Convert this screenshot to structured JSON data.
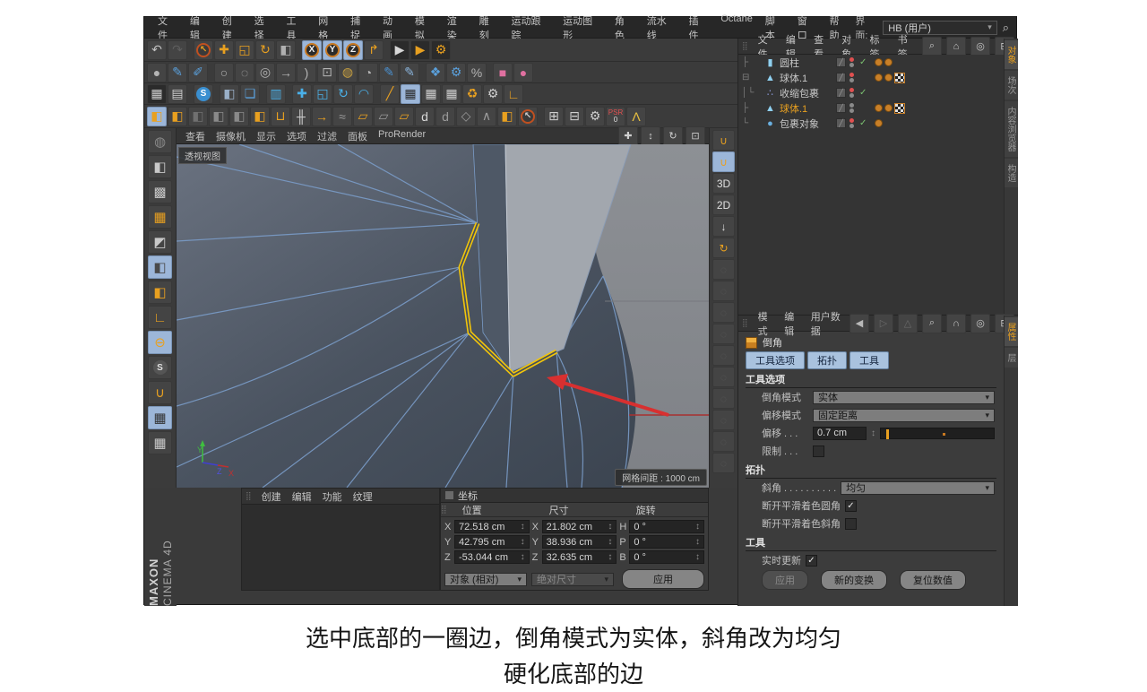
{
  "menubar": {
    "items": [
      "文件",
      "编辑",
      "创建",
      "选择",
      "工具",
      "网格",
      "捕捉",
      "动画",
      "模拟",
      "渲染",
      "雕刻",
      "运动跟踪",
      "运动图形",
      "角色",
      "流水线",
      "插件",
      "Octane",
      "脚本",
      "窗口",
      "帮助"
    ],
    "interface_label": "界面:",
    "interface_value": "HB (用户)",
    "search_glyph": "⌕"
  },
  "toolbars": {
    "row1": [
      {
        "n": "undo-icon",
        "g": "↶",
        "c": "#c0c0c0"
      },
      {
        "n": "redo-icon",
        "g": "↷",
        "c": "#5e5e5e"
      },
      {
        "sep": true
      },
      {
        "n": "live-selection-icon",
        "g": "↖",
        "c": "#e8a020",
        "circ": "#3a3a3a",
        "ring": "#c05020"
      },
      {
        "n": "move-icon",
        "g": "✚",
        "c": "#e8a020"
      },
      {
        "n": "scale-icon",
        "g": "◱",
        "c": "#e8a020"
      },
      {
        "n": "rotate-icon",
        "g": "↻",
        "c": "#e8a020"
      },
      {
        "n": "last-tool-icon",
        "g": "◧",
        "c": "#b0b0b0"
      },
      {
        "sep": true
      },
      {
        "n": "x-axis-lock-button",
        "g": "X",
        "c": "#f0f0f0",
        "circ": "#2b2b2b",
        "ring": "#c87820",
        "sel": true
      },
      {
        "n": "y-axis-lock-button",
        "g": "Y",
        "c": "#f0f0f0",
        "circ": "#2b2b2b",
        "ring": "#c87820",
        "sel": true
      },
      {
        "n": "z-axis-lock-button",
        "g": "Z",
        "c": "#f0f0f0",
        "circ": "#2b2b2b",
        "ring": "#c87820",
        "sel": true
      },
      {
        "n": "coord-system-icon",
        "g": "↱",
        "c": "#e8a020"
      },
      {
        "sep": true
      },
      {
        "n": "render-view-icon",
        "g": "▶",
        "c": "#d8d8d8",
        "bg": "#2b2b2b"
      },
      {
        "n": "render-to-picture-icon",
        "g": "▶",
        "c": "#e8a020",
        "bg": "#2b2b2b"
      },
      {
        "n": "render-settings-icon",
        "g": "⚙",
        "c": "#e8a020",
        "bg": "#2b2b2b"
      }
    ],
    "row2": [
      {
        "n": "add-sphere-icon",
        "g": "●",
        "c": "#b4b4b4"
      },
      {
        "n": "brush-icon",
        "g": "✎",
        "c": "#5aa0dc"
      },
      {
        "n": "brush-z-icon",
        "g": "✐",
        "c": "#5aa0dc"
      },
      {
        "sep": true
      },
      {
        "n": "circle-spline-icon",
        "g": "○",
        "c": "#b4b4b4"
      },
      {
        "n": "arc-spline-icon",
        "g": "◌",
        "c": "#b4b4b4"
      },
      {
        "n": "point-spline-icon",
        "g": "◎",
        "c": "#b4b4b4"
      },
      {
        "n": "point-move-icon",
        "g": "→",
        "c": "#b4b4b4"
      },
      {
        "n": "bracket-spline-icon",
        "g": ")",
        "c": "#b4b4b4"
      },
      {
        "n": "grid-points-icon",
        "g": "⊡",
        "c": "#b4b4b4"
      },
      {
        "n": "disc-icon",
        "g": "◍",
        "c": "#c8a040"
      },
      {
        "n": "sphere-pen-icon",
        "g": "◔",
        "c": "#b4b4b4"
      },
      {
        "n": "spline-pen-icon",
        "g": "✎",
        "c": "#4a90d0"
      },
      {
        "n": "spline-smooth-icon",
        "g": "✎",
        "c": "#8ab4dc"
      },
      {
        "sep": true
      },
      {
        "n": "mograph-icon",
        "g": "❖",
        "c": "#5aa0dc"
      },
      {
        "n": "mograph-gear-icon",
        "g": "⚙",
        "c": "#5aa0dc"
      },
      {
        "n": "percent-icon",
        "g": "%",
        "c": "#b4b4b4"
      },
      {
        "sep": true
      },
      {
        "n": "deform-cube-icon",
        "g": "■",
        "c": "#e070a0"
      },
      {
        "n": "deform-sphere-icon",
        "g": "●",
        "c": "#e070a0"
      }
    ],
    "row3": [
      {
        "n": "render-queue-icon",
        "g": "▦",
        "c": "#cfcfcf",
        "bg": "#2b2b2b"
      },
      {
        "n": "material-file-icon",
        "g": "▤",
        "c": "#cfcfcf"
      },
      {
        "sep": true
      },
      {
        "n": "snap-s-icon",
        "g": "S",
        "c": "#ffffff",
        "circ": "#3a8fd0"
      },
      {
        "sep": true
      },
      {
        "n": "cube-gray-icon",
        "g": "◧",
        "c": "#9ab0c8"
      },
      {
        "n": "cubes-icon",
        "g": "❏",
        "c": "#5aa0dc"
      },
      {
        "sep": true
      },
      {
        "n": "trash-icon",
        "g": "▥",
        "c": "#4ab0e8"
      },
      {
        "sep": true
      },
      {
        "n": "move-blue-icon",
        "g": "✚",
        "c": "#4ab0e8"
      },
      {
        "n": "scale-blue-icon",
        "g": "◱",
        "c": "#4ab0e8"
      },
      {
        "n": "rotate-blue-icon",
        "g": "↻",
        "c": "#4ab0e8"
      },
      {
        "n": "arc-blue-icon",
        "g": "◠",
        "c": "#4ab0e8"
      },
      {
        "sep": true
      },
      {
        "n": "pen-tilt-icon",
        "g": "╱",
        "c": "#e8a020"
      },
      {
        "n": "camera-lock-icon",
        "g": "▦",
        "c": "#2b2b2b",
        "sel": true
      },
      {
        "n": "camera-icon",
        "g": "▦",
        "c": "#cfcfcf"
      },
      {
        "n": "camera-alt-icon",
        "g": "▦",
        "c": "#cfcfcf"
      },
      {
        "n": "recycle-icon",
        "g": "♻",
        "c": "#e8a020"
      },
      {
        "n": "gear-small-icon",
        "g": "⚙",
        "c": "#cfcfcf"
      },
      {
        "n": "workplane-l1-icon",
        "g": "∟",
        "c": "#e8a020"
      }
    ],
    "row4": [
      {
        "n": "make-editable-icon",
        "g": "◧",
        "c": "#e8a020",
        "sel": true
      },
      {
        "n": "cube-orange-icon",
        "g": "◧",
        "c": "#e8a020"
      },
      {
        "n": "cube-disabled-icon",
        "g": "◧",
        "c": "#707070"
      },
      {
        "n": "cube-corner-icon",
        "g": "◧",
        "c": "#8a8a8a"
      },
      {
        "n": "cube-dark-icon",
        "g": "◧",
        "c": "#8a8a8a"
      },
      {
        "n": "cube-gear-icon",
        "g": "◧",
        "c": "#e8a020"
      },
      {
        "n": "drop-floor-icon",
        "g": "⊔",
        "c": "#e8a020"
      },
      {
        "n": "split-handles-icon",
        "g": "╫",
        "c": "#cfcfcf"
      },
      {
        "n": "arrow-dots-icon",
        "g": "→",
        "c": "#e8a020"
      },
      {
        "n": "mirror-icon",
        "g": "≈",
        "c": "#9a9a9a"
      },
      {
        "n": "slide-icon",
        "g": "▱",
        "c": "#e8a020"
      },
      {
        "n": "slide-alt-icon",
        "g": "▱",
        "c": "#9a9a9a"
      },
      {
        "n": "extrude-icon",
        "g": "▱",
        "c": "#e8a020"
      },
      {
        "n": "knife-d-icon",
        "g": "d",
        "c": "#d8d8d8"
      },
      {
        "n": "knife-d2-icon",
        "g": "d",
        "c": "#9a9a9a"
      },
      {
        "n": "polygon-pen-icon",
        "g": "◇",
        "c": "#9a9a9a"
      },
      {
        "n": "character-icon",
        "g": "∧",
        "c": "#9a9a9a"
      },
      {
        "n": "uv-cube-icon",
        "g": "◧",
        "c": "#e8a020"
      },
      {
        "n": "select-ring-icon",
        "g": "↖",
        "c": "#cfcfcf",
        "circ": "#3a3a3a",
        "ring": "#c05020"
      },
      {
        "sep": true
      },
      {
        "n": "grid-table-icon",
        "g": "⊞",
        "c": "#cfcfcf"
      },
      {
        "n": "grid-list-icon",
        "g": "⊟",
        "c": "#cfcfcf"
      },
      {
        "n": "gears-pair-icon",
        "g": "⚙",
        "c": "#cfcfcf"
      },
      {
        "n": "psr-badge",
        "g": "PSR",
        "c": "#e05050",
        "sm": true,
        "sub": "0"
      },
      {
        "n": "scales-icon",
        "g": "Λ",
        "c": "#e8c040"
      }
    ],
    "left": [
      {
        "n": "world-grid-icon",
        "g": "◍",
        "c": "#8a8a8a"
      },
      {
        "n": "model-mode-icon",
        "g": "◧",
        "c": "#c8c8c8"
      },
      {
        "n": "texture-mode-icon",
        "g": "▩",
        "c": "#c8c8c8"
      },
      {
        "n": "workplane-mode-icon",
        "g": "▦",
        "c": "#e8a020"
      },
      {
        "n": "points-mode-icon",
        "g": "◩",
        "c": "#c8c8c8"
      },
      {
        "n": "edges-mode-icon",
        "g": "◧",
        "c": "#4a4a4a",
        "sel": true
      },
      {
        "n": "polygons-mode-icon",
        "g": "◧",
        "c": "#e8a020"
      },
      {
        "n": "axis-mode-icon",
        "g": "∟",
        "c": "#e8a020"
      },
      {
        "n": "mouse-mode-icon",
        "g": "⊖",
        "c": "#e8a020",
        "sel": true
      },
      {
        "n": "snap-icon",
        "g": "S",
        "c": "#e0e0e0",
        "circ": "#555555"
      },
      {
        "n": "magnet-icon",
        "g": "∪",
        "c": "#e8a020"
      },
      {
        "n": "quantize-lock-icon",
        "g": "▦",
        "c": "#333333",
        "sel": true
      },
      {
        "n": "quantize-rotate-icon",
        "g": "▦",
        "c": "#c8c8c8"
      }
    ],
    "right": [
      {
        "n": "snap-magnet-icon",
        "g": "∪",
        "c": "#e8a020"
      },
      {
        "n": "snap-auto-icon",
        "g": "∪",
        "c": "#e8a020",
        "sel": true
      },
      {
        "n": "snap-3d-icon",
        "g": "3D",
        "c": "#e0e0e0",
        "sm": true
      },
      {
        "n": "snap-2d-icon",
        "g": "2D",
        "c": "#e0e0e0",
        "sm": true
      },
      {
        "n": "snap-down-icon",
        "g": "↓",
        "c": "#e0e0e0"
      },
      {
        "n": "rotate-band-icon",
        "g": "↻",
        "c": "#e8a020"
      },
      {
        "n": "disabled-tool-icon-1",
        "g": "◌",
        "c": "#5a5a5a"
      },
      {
        "n": "disabled-tool-icon-2",
        "g": "◌",
        "c": "#5a5a5a"
      },
      {
        "n": "disabled-tool-icon-3",
        "g": "◌",
        "c": "#5a5a5a"
      },
      {
        "n": "disabled-tool-icon-4",
        "g": "◌",
        "c": "#5a5a5a"
      },
      {
        "n": "disabled-tool-icon-5",
        "g": "◌",
        "c": "#5a5a5a"
      },
      {
        "n": "disabled-tool-icon-6",
        "g": "◌",
        "c": "#5a5a5a"
      },
      {
        "n": "disabled-tool-icon-7",
        "g": "◌",
        "c": "#5a5a5a"
      },
      {
        "n": "disabled-tool-icon-8",
        "g": "◌",
        "c": "#5a5a5a"
      },
      {
        "n": "disabled-tool-icon-9",
        "g": "◌",
        "c": "#5a5a5a"
      },
      {
        "n": "disabled-tool-icon-10",
        "g": "◌",
        "c": "#5a5a5a"
      }
    ]
  },
  "viewport": {
    "menu": [
      "查看",
      "摄像机",
      "显示",
      "选项",
      "过滤",
      "面板",
      "ProRender"
    ],
    "nav_icons": [
      {
        "n": "vp-move-icon",
        "g": "✚",
        "c": "#cfcfcf"
      },
      {
        "n": "vp-zoom-icon",
        "g": "↕",
        "c": "#cfcfcf"
      },
      {
        "n": "vp-rotate-icon",
        "g": "↻",
        "c": "#cfcfcf"
      },
      {
        "n": "vp-toggle-icon",
        "g": "⊡",
        "c": "#cfcfcf"
      }
    ],
    "label": "透视视图",
    "grid_label": "网格间距 : 1000 cm",
    "axis": {
      "x": "X",
      "y": "Y",
      "z": "Z"
    }
  },
  "object_manager": {
    "menu": [
      "文件",
      "编辑",
      "查看",
      "对象",
      "标签",
      "书签"
    ],
    "header_icons": [
      {
        "n": "search-icon",
        "g": "⌕",
        "c": "#c8c8c8"
      },
      {
        "n": "home-icon",
        "g": "⌂",
        "c": "#c8c8c8"
      },
      {
        "n": "filter-icon",
        "g": "◎",
        "c": "#c8c8c8"
      },
      {
        "n": "add-panel-icon",
        "g": "⊞",
        "c": "#c8c8c8"
      }
    ],
    "objects": [
      {
        "name": "圆柱",
        "tree": "├",
        "icon_name": "cylinder-icon",
        "icon": "▮",
        "icon_color": "#8fd0f0",
        "selected": false,
        "dot_top": "#e05050",
        "dot_bot": "#8a8a8a",
        "check": true,
        "tags": [
          "dot",
          "dot"
        ]
      },
      {
        "name": "球体.1",
        "tree": "⊟",
        "icon_name": "metaball-icon",
        "icon": "▲",
        "icon_color": "#8fd0f0",
        "selected": false,
        "dot_top": "#e05050",
        "dot_bot": "#8a8a8a",
        "check": false,
        "tags": [
          "dot",
          "dot",
          "checker"
        ]
      },
      {
        "name": "收缩包裹",
        "tree": "│└",
        "icon_name": "shrink-wrap-icon",
        "icon": "∴",
        "icon_color": "#93a3e8",
        "selected": false,
        "dot_top": "#e05050",
        "dot_bot": "#8a8a8a",
        "check": true,
        "tags": []
      },
      {
        "name": "球体.1",
        "tree": "├",
        "icon_name": "metaball-icon",
        "icon": "▲",
        "icon_color": "#8fd0f0",
        "selected": true,
        "dot_top": "#8a8a8a",
        "dot_bot": "#8a8a8a",
        "check": false,
        "tags": [
          "dot",
          "dot",
          "checker"
        ]
      },
      {
        "name": "包裹对象",
        "tree": "└",
        "icon_name": "sphere-object-icon",
        "icon": "●",
        "icon_color": "#6ab0e0",
        "selected": false,
        "dot_top": "#e05050",
        "dot_bot": "#8a8a8a",
        "check": true,
        "tags": [
          "dot"
        ]
      }
    ],
    "tabs": [
      {
        "label": "对象",
        "active": true
      },
      {
        "label": "场次",
        "active": false
      },
      {
        "label": "内容浏览器",
        "active": false
      },
      {
        "label": "构造",
        "active": false
      }
    ]
  },
  "attributes": {
    "menu": [
      "模式",
      "编辑",
      "用户数据"
    ],
    "header_icons": [
      {
        "n": "back-icon",
        "g": "◀",
        "c": "#b8b8b8"
      },
      {
        "n": "forward-icon",
        "g": "▷",
        "c": "#6a6a6a"
      },
      {
        "n": "up-icon",
        "g": "△",
        "c": "#6a6a6a"
      },
      {
        "n": "search-icon",
        "g": "⌕",
        "c": "#c8c8c8"
      },
      {
        "n": "lock-icon",
        "g": "∩",
        "c": "#c8c8c8"
      },
      {
        "n": "target-icon",
        "g": "◎",
        "c": "#c8c8c8"
      },
      {
        "n": "add-panel-icon",
        "g": "⊞",
        "c": "#c8c8c8"
      }
    ],
    "object_title": "倒角",
    "tabs": [
      "工具选项",
      "拓扑",
      "工具"
    ],
    "tool_options": {
      "header": "工具选项",
      "bevel_mode_label": "倒角模式",
      "bevel_mode_value": "实体",
      "offset_mode_label": "偏移模式",
      "offset_mode_value": "固定距离",
      "offset_label": "偏移 . . .",
      "offset_value": "0.7 cm",
      "limit_label": "限制 . . ."
    },
    "topology": {
      "header": "拓扑",
      "miter_label": "斜角 . . . . . . . . . .",
      "miter_value": "均匀",
      "phong_round_label": "断开平滑着色圆角",
      "phong_miter_label": "断开平滑着色斜角"
    },
    "tool": {
      "header": "工具",
      "realtime_label": "实时更新",
      "apply_label": "应用",
      "new_transform_label": "新的变换",
      "reset_label": "复位数值"
    },
    "tabs_vertical": [
      {
        "label": "属性",
        "active": true
      },
      {
        "label": "层",
        "active": false
      }
    ],
    "check_glyph": "✓",
    "spin_glyph": "↕",
    "arrow_glyph": "▾"
  },
  "coordinates": {
    "title": "坐标",
    "col_headers": [
      "位置",
      "尺寸",
      "旋转"
    ],
    "fields": [
      {
        "axis": "X",
        "value": "72.518 cm"
      },
      {
        "axis": "Y",
        "value": "42.795 cm"
      },
      {
        "axis": "Z",
        "value": "-53.044 cm"
      },
      {
        "axis": "X",
        "value": "21.802 cm"
      },
      {
        "axis": "Y",
        "value": "38.936 cm"
      },
      {
        "axis": "Z",
        "value": "32.635 cm"
      },
      {
        "axis": "H",
        "value": "0 °"
      },
      {
        "axis": "P",
        "value": "0 °"
      },
      {
        "axis": "B",
        "value": "0 °"
      }
    ],
    "position_mode": "对象 (相对)",
    "size_mode": "绝对尺寸",
    "apply_label": "应用"
  },
  "materials": {
    "menu": [
      "创建",
      "编辑",
      "功能",
      "纹理"
    ]
  },
  "branding": {
    "maxon": "MAXON",
    "cinema": "CINEMA 4D"
  },
  "caption": {
    "line1": "选中底部的一圈边，倒角模式为实体，斜角改为均匀",
    "line2": "硬化底部的边"
  },
  "colors": {
    "accent_orange": "#e8a020",
    "selection_blue": "#9cb6d8",
    "bevel_yellow": "#f2c50a",
    "wire_blue": "#7a9cc8",
    "arrow_red": "#d83030"
  },
  "grip_glyph": "⣿"
}
